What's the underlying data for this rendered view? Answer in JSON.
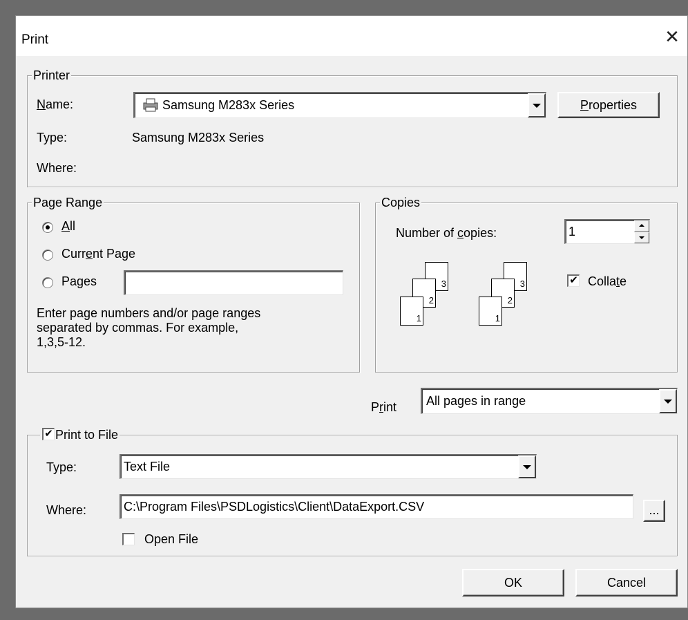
{
  "window": {
    "title": "Print"
  },
  "printer": {
    "legend": "Printer",
    "name_label": "Name:",
    "name_value": "Samsung M283x Series",
    "properties_button": "Properties",
    "type_label": "Type:",
    "type_value": "Samsung M283x Series",
    "where_label": "Where:",
    "where_value": ""
  },
  "page_range": {
    "legend": "Page Range",
    "options": [
      {
        "label": "All",
        "selected": true
      },
      {
        "label": "Current Page",
        "selected": false
      },
      {
        "label": "Pages",
        "selected": false
      }
    ],
    "pages_value": "",
    "hint_lines": [
      "Enter page numbers and/or page ranges",
      "separated by commas.  For example,",
      "1,3,5-12."
    ]
  },
  "copies": {
    "legend": "Copies",
    "number_label": "Number of copies:",
    "number_value": "1",
    "collate_label": "Collate",
    "collate_checked": true,
    "page_numbers": [
      "1",
      "2",
      "3"
    ]
  },
  "print_select": {
    "label": "Print",
    "value": "All pages in range"
  },
  "print_to_file": {
    "legend": "Print to File",
    "checked": true,
    "type_label": "Type:",
    "type_value": "Text File",
    "where_label": "Where:",
    "where_value": "C:\\Program Files\\PSDLogistics\\Client\\DataExport.CSV",
    "browse_label": "...",
    "open_file_label": "Open File",
    "open_file_checked": false
  },
  "buttons": {
    "ok": "OK",
    "cancel": "Cancel"
  },
  "icons": {
    "printer": "printer-icon",
    "close": "close-icon",
    "check_mark": "✔",
    "close_glyph": "✕"
  }
}
